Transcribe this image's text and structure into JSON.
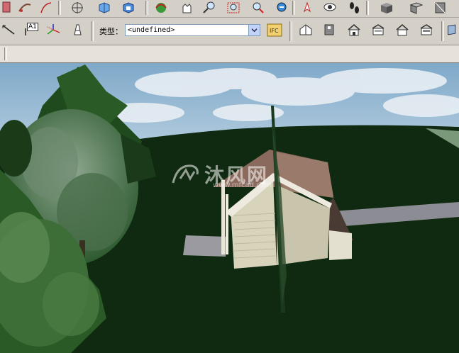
{
  "toolbar": {
    "type_label": "类型：",
    "type_value": "<undefined>",
    "text_tool_label": "A1"
  },
  "watermark": {
    "brand": "沐风网",
    "url": "www.mfcad.com"
  },
  "colors": {
    "toolbar_bg": "#d4d0c8",
    "ground": "#0f2a10",
    "sky": "#7aa6c8",
    "house_siding": "#d8d4bc",
    "roof": "#8a6a5c",
    "driveway": "#8c8c94"
  }
}
